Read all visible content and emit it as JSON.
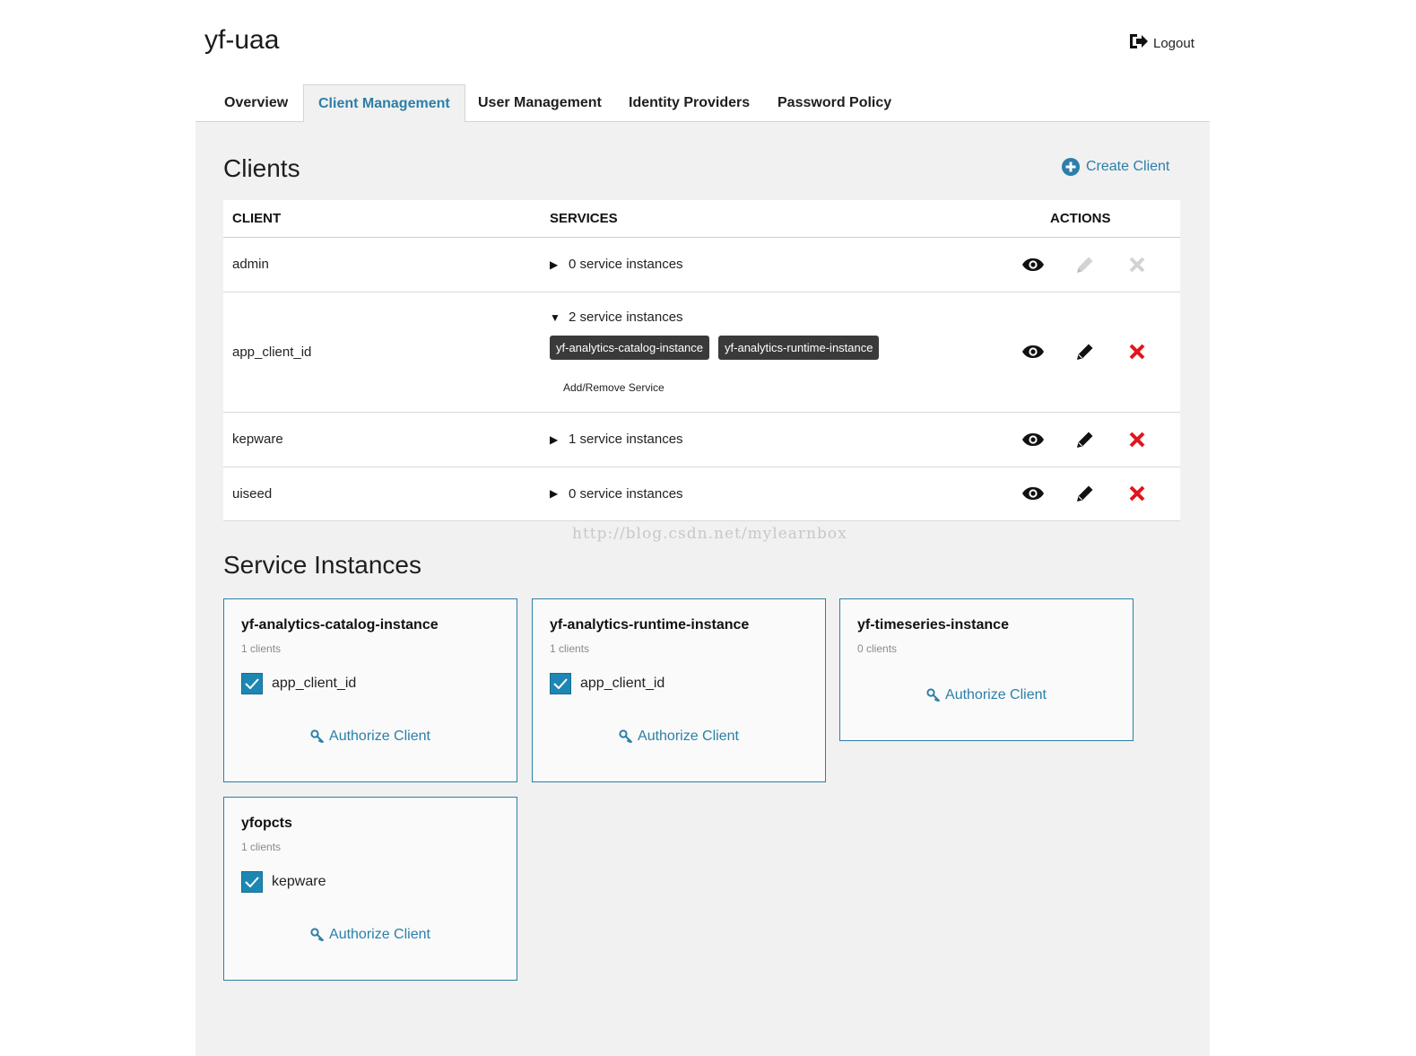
{
  "app": {
    "title": "yf-uaa",
    "logout_label": "Logout"
  },
  "tabs": [
    {
      "label": "Overview"
    },
    {
      "label": "Client Management"
    },
    {
      "label": "User Management"
    },
    {
      "label": "Identity Providers"
    },
    {
      "label": "Password Policy"
    }
  ],
  "active_tab": "Client Management",
  "clients_section": {
    "title": "Clients",
    "create_label": "Create Client",
    "headers": {
      "client": "CLIENT",
      "services": "SERVICES",
      "actions": "ACTIONS"
    },
    "rows": [
      {
        "client": "admin",
        "services_label": "0 service instances",
        "expanded": false,
        "actions_enabled": false
      },
      {
        "client": "app_client_id",
        "services_label": "2 service instances",
        "expanded": true,
        "service_tags": [
          "yf-analytics-catalog-instance",
          "yf-analytics-runtime-instance"
        ],
        "add_remove_label": "Add/Remove Service",
        "actions_enabled": true
      },
      {
        "client": "kepware",
        "services_label": "1 service instances",
        "expanded": false,
        "actions_enabled": true
      },
      {
        "client": "uiseed",
        "services_label": "0 service instances",
        "expanded": false,
        "actions_enabled": true
      }
    ]
  },
  "watermark": "http://blog.csdn.net/mylearnbox",
  "instances_section": {
    "title": "Service Instances",
    "authorize_label": "Authorize Client",
    "cards": [
      {
        "name": "yf-analytics-catalog-instance",
        "count": "1 clients",
        "clients": [
          "app_client_id"
        ]
      },
      {
        "name": "yf-analytics-runtime-instance",
        "count": "1 clients",
        "clients": [
          "app_client_id"
        ]
      },
      {
        "name": "yf-timeseries-instance",
        "count": "0 clients",
        "clients": []
      },
      {
        "name": "yfopcts",
        "count": "1 clients",
        "clients": [
          "kepware"
        ]
      }
    ]
  },
  "icons": {
    "view": "eye-icon",
    "edit": "pencil-icon",
    "delete": "x-icon",
    "logout": "logout-icon",
    "create": "plus-circle-icon",
    "authorize": "key-icon",
    "check": "check-icon"
  },
  "colors": {
    "accent": "#2c7fa8",
    "delete": "#e0161e",
    "disabled": "#d3d3d3",
    "tag_bg": "#3a3a3a",
    "checkbox": "#1d87b3"
  }
}
